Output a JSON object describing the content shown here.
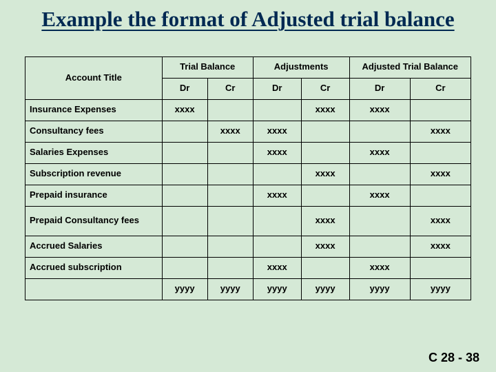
{
  "title": "Example the format of Adjusted trial balance",
  "headers": {
    "account": "Account Title",
    "tb": "Trial Balance",
    "adj": "Adjustments",
    "atb": "Adjusted Trial Balance",
    "dr": "Dr",
    "cr": "Cr"
  },
  "rows": [
    {
      "acct": "Insurance Expenses",
      "tb_dr": "xxxx",
      "tb_cr": "",
      "adj_dr": "",
      "adj_cr": "xxxx",
      "atb_dr": "xxxx",
      "atb_cr": ""
    },
    {
      "acct": "Consultancy fees",
      "tb_dr": "",
      "tb_cr": "xxxx",
      "adj_dr": "xxxx",
      "adj_cr": "",
      "atb_dr": "",
      "atb_cr": "xxxx"
    },
    {
      "acct": "Salaries Expenses",
      "tb_dr": "",
      "tb_cr": "",
      "adj_dr": "xxxx",
      "adj_cr": "",
      "atb_dr": "xxxx",
      "atb_cr": ""
    },
    {
      "acct": "Subscription revenue",
      "tb_dr": "",
      "tb_cr": "",
      "adj_dr": "",
      "adj_cr": "xxxx",
      "atb_dr": "",
      "atb_cr": "xxxx"
    },
    {
      "acct": "Prepaid insurance",
      "tb_dr": "",
      "tb_cr": "",
      "adj_dr": "xxxx",
      "adj_cr": "",
      "atb_dr": "xxxx",
      "atb_cr": ""
    },
    {
      "acct": "Prepaid Consultancy fees",
      "tb_dr": "",
      "tb_cr": "",
      "adj_dr": "",
      "adj_cr": "xxxx",
      "atb_dr": "",
      "atb_cr": "xxxx",
      "twoline": true
    },
    {
      "acct": "Accrued Salaries",
      "tb_dr": "",
      "tb_cr": "",
      "adj_dr": "",
      "adj_cr": "xxxx",
      "atb_dr": "",
      "atb_cr": "xxxx"
    },
    {
      "acct": "Accrued subscription",
      "tb_dr": "",
      "tb_cr": "",
      "adj_dr": "xxxx",
      "adj_cr": "",
      "atb_dr": "xxxx",
      "atb_cr": ""
    }
  ],
  "totals": {
    "tb_dr": "yyyy",
    "tb_cr": "yyyy",
    "adj_dr": "yyyy",
    "adj_cr": "yyyy",
    "atb_dr": "yyyy",
    "atb_cr": "yyyy"
  },
  "footer": "C 28 - 38"
}
